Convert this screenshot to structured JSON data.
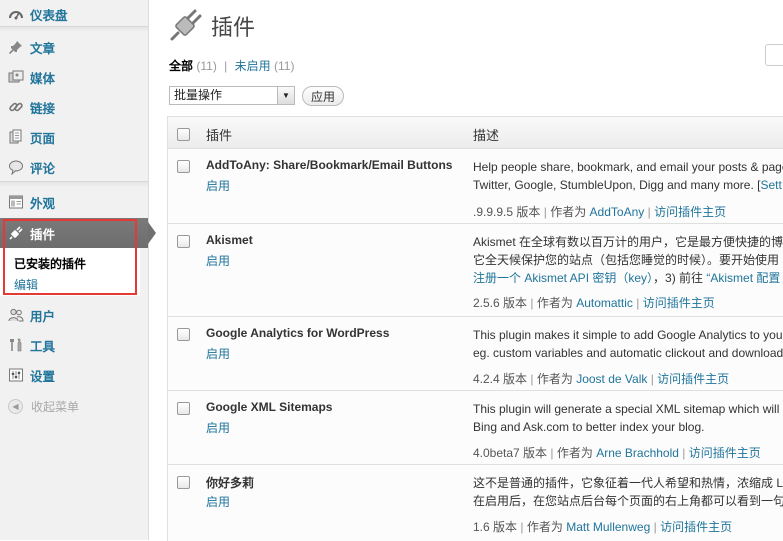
{
  "sidebar": {
    "items": [
      {
        "key": "dashboard",
        "label": "仪表盘",
        "icon": "dashboard-icon"
      },
      {
        "key": "posts",
        "label": "文章",
        "icon": "pushpin-icon"
      },
      {
        "key": "media",
        "label": "媒体",
        "icon": "media-icon"
      },
      {
        "key": "links",
        "label": "链接",
        "icon": "link-icon"
      },
      {
        "key": "pages",
        "label": "页面",
        "icon": "page-icon"
      },
      {
        "key": "comments",
        "label": "评论",
        "icon": "comment-icon"
      },
      {
        "key": "appearance",
        "label": "外观",
        "icon": "appearance-icon"
      },
      {
        "key": "plugins",
        "label": "插件",
        "icon": "plug-icon"
      },
      {
        "key": "users",
        "label": "用户",
        "icon": "users-icon"
      },
      {
        "key": "tools",
        "label": "工具",
        "icon": "tools-icon"
      },
      {
        "key": "settings",
        "label": "设置",
        "icon": "settings-icon"
      }
    ],
    "submenu": {
      "installed": "已安装的插件",
      "edit": "编辑"
    },
    "collapse_label": "收起菜单"
  },
  "header": {
    "title": "插件"
  },
  "filters": {
    "all_label": "全部",
    "all_count": "(11)",
    "inactive_label": "未启用",
    "inactive_count": "(11)"
  },
  "bulk": {
    "selected": "批量操作",
    "apply_label": "应用"
  },
  "table": {
    "col_plugin": "插件",
    "col_desc": "描述",
    "rows": [
      {
        "name": "AddToAny: Share/Bookmark/Email Buttons",
        "activate": "启用",
        "desc1": "Help people share, bookmark, and email your posts & pages",
        "desc2a": "Twitter, Google, StumbleUpon, Digg and many more. [",
        "desc2b": "Sett",
        "version": ".9.9.9.5 版本",
        "author_pre": "作者为",
        "author": "AddToAny",
        "visit": "访问插件主页"
      },
      {
        "name": "Akismet",
        "activate": "启用",
        "desc1": "Akismet 在全球有数以百万计的用户，它是最方便快捷的博",
        "desc2a": "它全天候保护您的站点（包括您睡觉的时候）。要开始使用",
        "desc3a": "注册一个 Akismet API 密钥（key）",
        "desc3b": "，3) 前往",
        "desc3c": "“Akismet 配置",
        "version": "2.5.6 版本",
        "author_pre": "作者为",
        "author": "Automattic",
        "visit": "访问插件主页"
      },
      {
        "name": "Google Analytics for WordPress",
        "activate": "启用",
        "desc1": "This plugin makes it simple to add Google Analytics to your",
        "desc2a": "eg. custom variables and automatic clickout and download",
        "version": "4.2.4 版本",
        "author_pre": "作者为",
        "author": "Joost de Valk",
        "visit": "访问插件主页"
      },
      {
        "name": "Google XML Sitemaps",
        "activate": "启用",
        "desc1": "This plugin will generate a special XML sitemap which will",
        "desc2a": "Bing and Ask.com to better index your blog.",
        "version": "4.0beta7 版本",
        "author_pre": "作者为",
        "author": "Arne Brachhold",
        "visit": "访问插件主页"
      },
      {
        "name": "你好多莉",
        "activate": "启用",
        "desc1": "这不是普通的插件，它象征着一代人希望和热情，浓缩成 L",
        "desc2a": "在启用后，在您站点后台每个页面的右上角都可以看到一句",
        "version": "1.6 版本",
        "author_pre": "作者为",
        "author": "Matt Mullenweg",
        "visit": "访问插件主页"
      }
    ]
  }
}
